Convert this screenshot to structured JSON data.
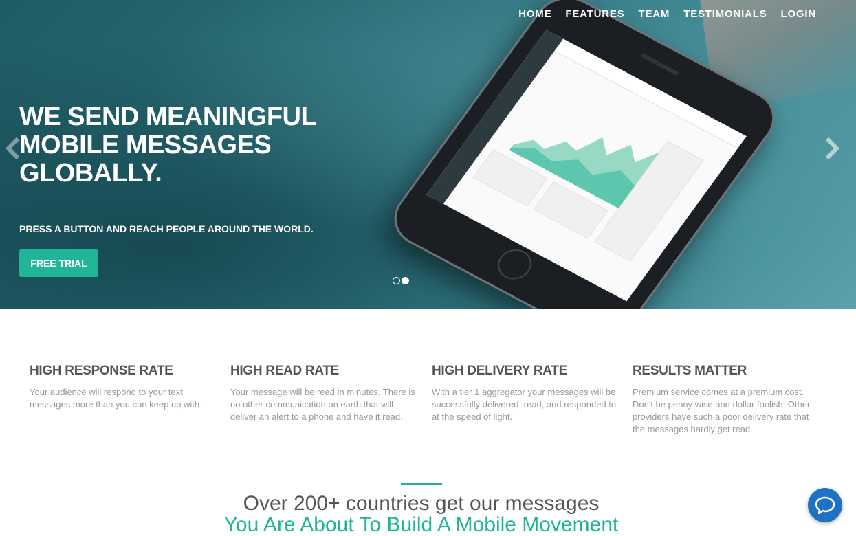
{
  "nav": {
    "items": [
      {
        "label": "HOME"
      },
      {
        "label": "FEATURES"
      },
      {
        "label": "TEAM"
      },
      {
        "label": "TESTIMONIALS"
      },
      {
        "label": "LOGIN"
      }
    ]
  },
  "hero": {
    "title_line1": "WE SEND MEANINGFUL",
    "title_line2": "MOBILE MESSAGES",
    "title_line3": "GLOBALLY.",
    "subtitle": "PRESS A BUTTON AND REACH PEOPLE AROUND THE WORLD.",
    "cta_label": "FREE TRIAL",
    "slides": 2,
    "active_slide": 2,
    "accent_color": "#1fb596"
  },
  "features": [
    {
      "title": "HIGH RESPONSE RATE",
      "text": "Your audience will respond to your text messages more than you can keep up with."
    },
    {
      "title": "HIGH READ RATE",
      "text": "Your message will be read in minutes. There is no other communication on earth that will deliver an alert to a phone and have it read."
    },
    {
      "title": "HIGH DELIVERY RATE",
      "text": "With a tier 1 aggregator your messages will be successfully delivered, read, and responded to at the speed of light."
    },
    {
      "title": "RESULTS MATTER",
      "text": "Premium service comes at a premium cost. Don't be penny wise and dollar foolish. Other providers have such a poor delivery rate that the messages hardly get read."
    }
  ],
  "section": {
    "headline": "Over 200+ countries get our messages",
    "tagline": "You Are About To Build A Mobile Movement"
  },
  "icons": {
    "prev": "chevron-left-icon",
    "next": "chevron-right-icon",
    "chat": "chat-bubble-icon"
  }
}
